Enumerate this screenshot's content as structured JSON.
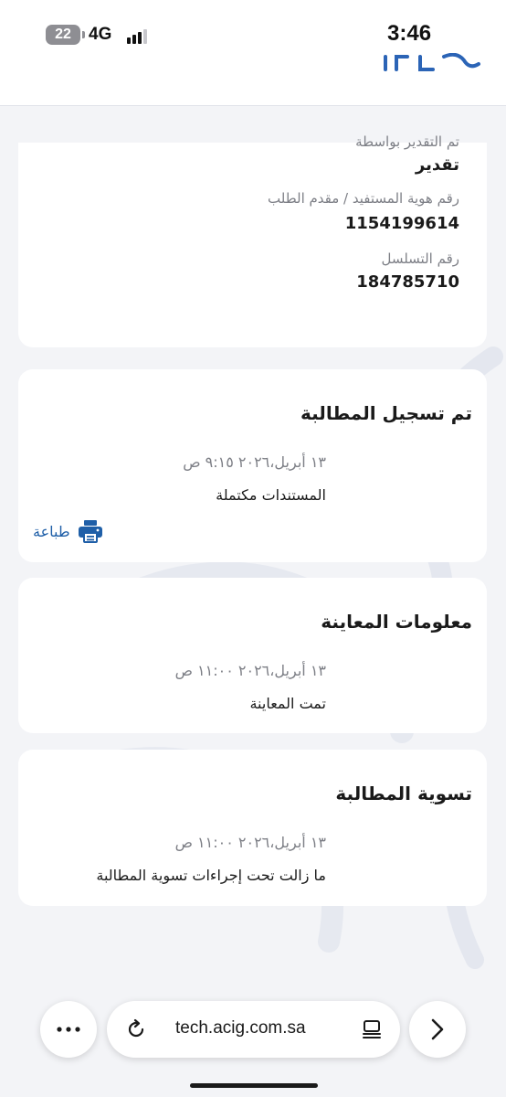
{
  "status_bar": {
    "battery": "22",
    "network": "4G",
    "time": "3:46"
  },
  "claim_info": {
    "assessor_label": "تم التقدير بواسطة",
    "assessor_value": "تقدير",
    "id_label": "رقم هوية المستفيد / مقدم الطلب",
    "id_value": "1154199614",
    "serial_label": "رقم التسلسل",
    "serial_value": "184785710"
  },
  "timeline": [
    {
      "title": "تم تسجيل المطالبة",
      "date": "١٣ أبريل،٢٠٢٦ ٩:١٥ ص",
      "status": "المستندات مكتملة",
      "print_label": "طباعة"
    },
    {
      "title": "معلومات المعاينة",
      "date": "١٣ أبريل،٢٠٢٦ ١١:٠٠ ص",
      "status": "تمت المعاينة"
    },
    {
      "title": "تسوية المطالبة",
      "date": "١٣ أبريل،٢٠٢٦ ١١:٠٠ ص",
      "status": "ما زالت تحت إجراءات تسوية المطالبة"
    }
  ],
  "browser": {
    "url": "tech.acig.com.sa",
    "more_icon": "ellipsis-icon",
    "reload_icon": "reload-icon",
    "reader_icon": "reader-icon",
    "forward_icon": "chevron-right-icon"
  },
  "colors": {
    "accent": "#1f5fa8",
    "background": "#f3f4f7",
    "card": "#ffffff",
    "muted_text": "#7d7f86"
  }
}
